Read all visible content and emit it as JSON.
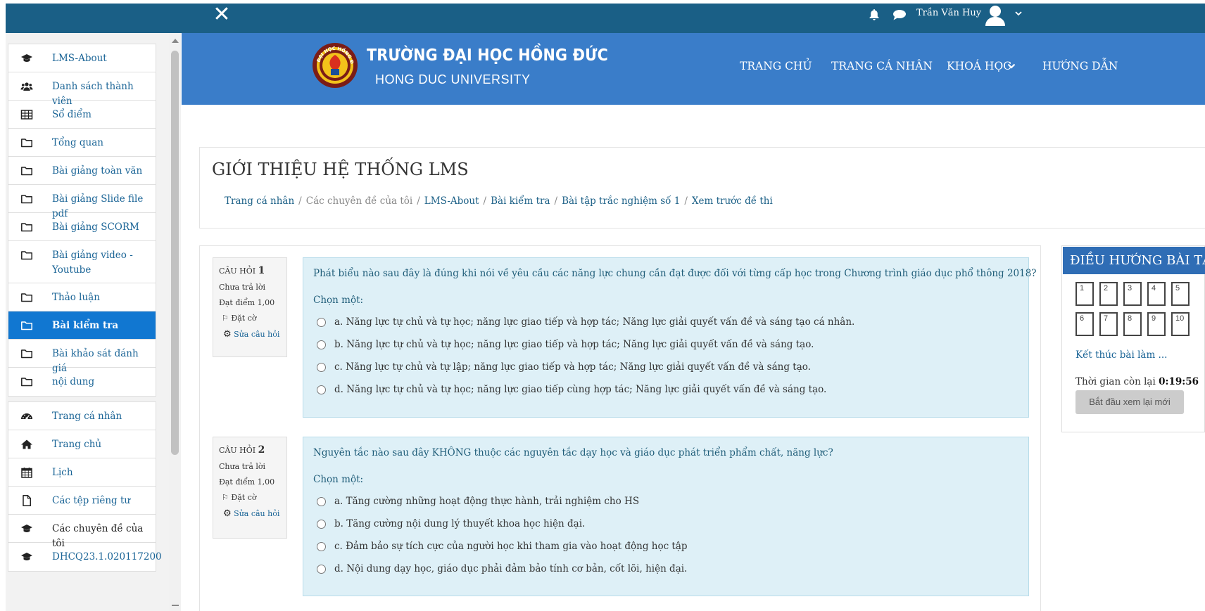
{
  "topbar": {
    "close_glyph": "✕",
    "user_name": "Trần Văn Huy"
  },
  "sidebar": {
    "course_block": [
      {
        "label": "LMS-About",
        "icon": "graduation-cap-icon"
      },
      {
        "label": "Danh sách thành viên",
        "icon": "users-icon"
      },
      {
        "label": "Sổ điểm",
        "icon": "table-icon"
      },
      {
        "label": "Tổng quan",
        "icon": "folder-icon"
      },
      {
        "label": "Bài giảng toàn văn",
        "icon": "folder-icon"
      },
      {
        "label": "Bài giảng Slide file pdf",
        "icon": "folder-icon"
      },
      {
        "label": "Bài giảng SCORM",
        "icon": "folder-icon"
      },
      {
        "label": "Bài giảng video - Youtube",
        "icon": "folder-icon"
      },
      {
        "label": "Thảo luận",
        "icon": "folder-icon"
      },
      {
        "label": "Bài kiểm tra",
        "icon": "folder-icon",
        "active": true
      },
      {
        "label": "Bài khảo sát đánh giá",
        "icon": "folder-icon"
      },
      {
        "label": "nội dung",
        "icon": "folder-icon"
      }
    ],
    "site_block": [
      {
        "label": "Trang cá nhân",
        "icon": "dashboard-icon"
      },
      {
        "label": "Trang chủ",
        "icon": "home-icon"
      },
      {
        "label": "Lịch",
        "icon": "calendar-icon"
      },
      {
        "label": "Các tệp riêng tư",
        "icon": "file-icon"
      },
      {
        "label": "Các chuyên đề của tôi",
        "icon": "graduation-cap-icon"
      },
      {
        "label": "DHCQ23.1.020117200",
        "icon": "graduation-cap-icon"
      }
    ]
  },
  "header": {
    "brand_line1": "TRƯỜNG ĐẠI HỌC HỒNG ĐỨC",
    "brand_line2": "HONG DUC UNIVERSITY",
    "logo_text": "ĐẠI HỌC HỒNG ĐỨC",
    "nav": [
      "TRANG CHỦ",
      "TRANG CÁ NHÂN",
      "KHOÁ HỌC",
      "HƯỚNG DẪN"
    ]
  },
  "page": {
    "title": "GIỚI THIỆU HỆ THỐNG LMS",
    "breadcrumb": [
      "Trang cá nhân",
      "Các chuyên đề của tôi",
      "LMS-About",
      "Bài kiểm tra",
      "Bài tập trắc nghiệm số 1",
      "Xem trước đề thi"
    ],
    "breadcrumb_sep": "/"
  },
  "questions": [
    {
      "label": "CÂU HỎI",
      "number": "1",
      "status": "Chưa trả lời",
      "points": "Đạt điểm 1,00",
      "flag": "Đặt cờ",
      "edit": "Sửa câu hỏi",
      "text": "Phát biểu nào sau đây là đúng khi nói về yêu cầu các năng lực chung cần đạt được đối với từng cấp học trong Chương trình giáo dục phổ thông 2018?",
      "prompt": "Chọn một:",
      "options": [
        "a. Năng lực tự chủ và tự học; năng lực giao tiếp và hợp tác; Năng lực giải quyết vấn đề và sáng tạo cá nhân.",
        "b. Năng lực tự chủ và tự học; năng lực giao tiếp và hợp tác; Năng lực giải quyết vấn đề và sáng tạo.",
        "c. Năng lực tự chủ và tự lập; năng lực giao tiếp và hợp tác; Năng lực giải quyết vấn đề và sáng tạo.",
        "d. Năng lực tự chủ và tự học; năng lực giao tiếp cùng hợp tác; Năng lực giải quyết vấn đề và sáng tạo."
      ]
    },
    {
      "label": "CÂU HỎI",
      "number": "2",
      "status": "Chưa trả lời",
      "points": "Đạt điểm 1,00",
      "flag": "Đặt cờ",
      "edit": "Sửa câu hỏi",
      "text": "Nguyên tắc nào sau đây KHÔNG thuộc các nguyên tắc dạy học và giáo dục phát triển phẩm chất, năng lực?",
      "prompt": "Chọn một:",
      "options": [
        "a. Tăng cường những hoạt động thực hành, trải nghiệm cho HS",
        "b. Tăng cường nội dung lý thuyết khoa học hiện đại.",
        "c. Đảm bảo sự tích cực của người học khi tham gia vào hoạt động học tập",
        "d. Nội dung dạy học, giáo dục phải đảm bảo tính cơ bản, cốt lõi, hiện đại."
      ]
    }
  ],
  "quiz_nav": {
    "title": "ĐIỀU HƯỚNG BÀI TẬP",
    "buttons": [
      "1",
      "2",
      "3",
      "4",
      "5",
      "6",
      "7",
      "8",
      "9",
      "10"
    ],
    "finish": "Kết thúc bài làm ...",
    "time_label": "Thời gian còn lại",
    "time_value": "0:19:56",
    "restart": "Bắt đầu xem lại mới"
  },
  "colors": {
    "topbar": "#1a5f86",
    "header": "#3a7dc9",
    "active": "#1177d1",
    "question_bg": "#def0f7",
    "nav_title": "#2f6db5"
  }
}
